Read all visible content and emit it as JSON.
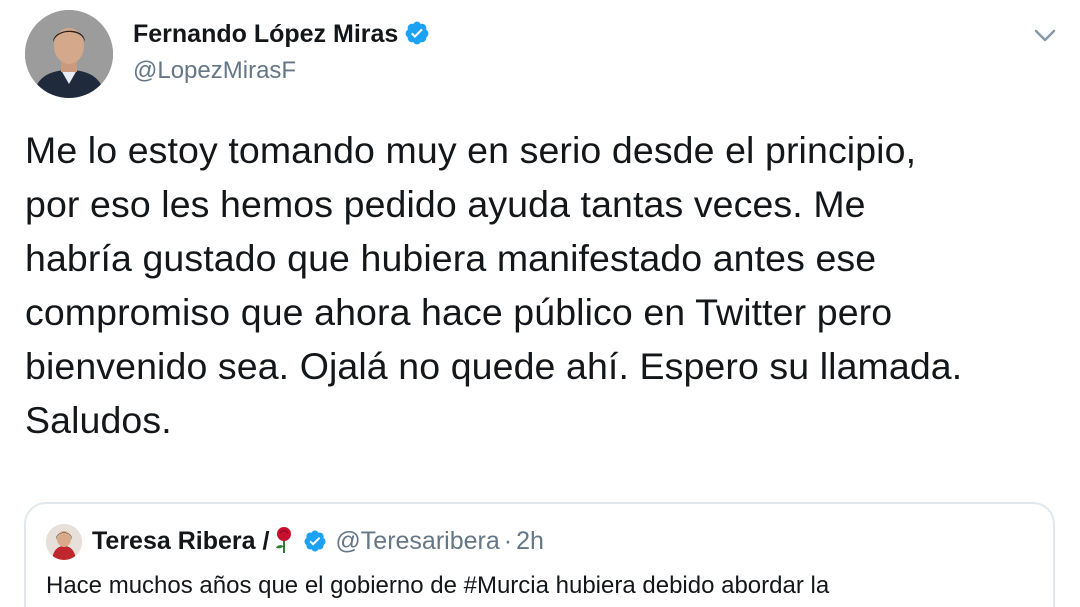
{
  "author": {
    "name": "Fernando López Miras",
    "handle": "@LopezMirasF",
    "verified": true
  },
  "menu": {
    "icon": "chevron-down-icon"
  },
  "tweet": {
    "lines": [
      "Me lo estoy tomando muy en serio desde el principio,",
      "por eso les hemos pedido ayuda tantas veces. Me",
      "habría gustado que hubiera manifestado antes ese",
      "compromiso que ahora hace público en Twitter pero",
      "bienvenido sea. Ojalá no quede ahí. Espero su llamada.",
      "Saludos."
    ]
  },
  "quoted": {
    "name": "Teresa Ribera /",
    "emoji": "rose-icon",
    "verified": true,
    "handle": "@Teresaribera",
    "separator": "·",
    "time": "2h",
    "text": "Hace muchos años que el gobierno de #Murcia hubiera debido abordar la"
  },
  "colors": {
    "primary_text": "#14171a",
    "secondary_text": "#657786",
    "verified_blue": "#1da1f2",
    "border": "#e1e8ed"
  }
}
